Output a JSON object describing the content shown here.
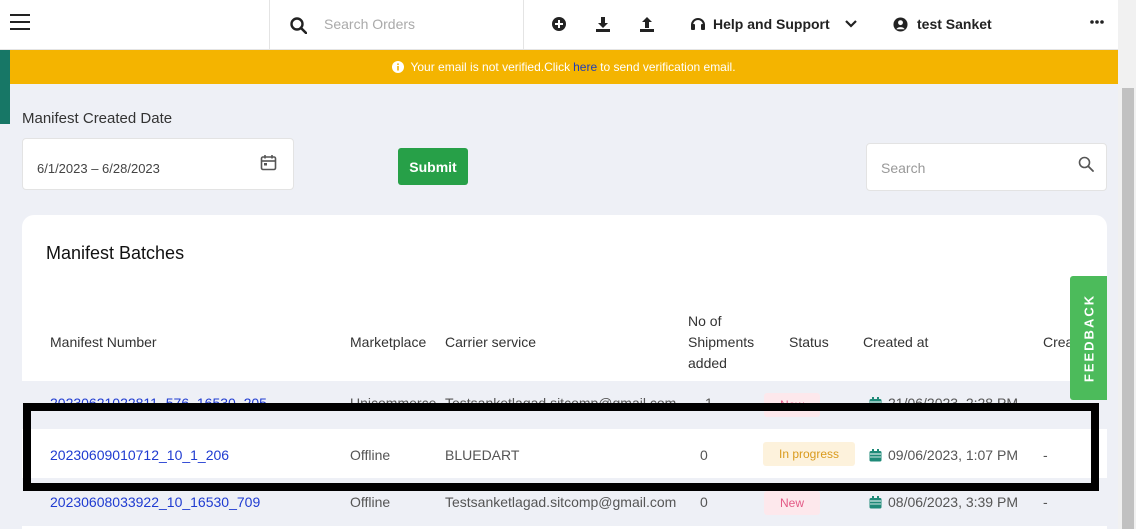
{
  "topbar": {
    "search_placeholder": "Search Orders",
    "help_label": "Help and Support",
    "user_name": "test Sanket"
  },
  "notice": {
    "text_before": "Your email is not verified.Click",
    "link": "here",
    "text_after": "to send verification email."
  },
  "filter": {
    "label": "Manifest Created Date",
    "date_range": "6/1/2023 – 6/28/2023",
    "submit_label": "Submit",
    "search_placeholder": "Search"
  },
  "card": {
    "title": "Manifest Batches",
    "headers": {
      "manifest_number": "Manifest Number",
      "marketplace": "Marketplace",
      "carrier_service": "Carrier service",
      "shipments_added": "No of\nShipments\nadded",
      "status": "Status",
      "created_at": "Created at",
      "created_by": "Crea"
    },
    "rows": [
      {
        "number": "20230621022811_576_16530_205",
        "marketplace": "Unicommerce",
        "carrier": "Testsanketlagad.sitcomp@gmail.com",
        "shipments": "1",
        "status": "New",
        "status_color": "#e35a86",
        "created_at": "21/06/2023, 2:28 PM",
        "created_by": ""
      },
      {
        "number": "20230609010712_10_1_206",
        "marketplace": "Offline",
        "carrier": "BLUEDART",
        "shipments": "0",
        "status": "In progress",
        "status_color": "#d99a1c",
        "created_at": "09/06/2023, 1:07 PM",
        "created_by": "-"
      },
      {
        "number": "20230608033922_10_16530_709",
        "marketplace": "Offline",
        "carrier": "Testsanketlagad.sitcomp@gmail.com",
        "shipments": "0",
        "status": "New",
        "status_color": "#e35a86",
        "created_at": "08/06/2023, 3:39 PM",
        "created_by": "-"
      }
    ]
  },
  "feedback_label": "FEEDBACK",
  "colors": {
    "notice_bg": "#f4b400",
    "submit_bg": "#27a048",
    "link": "#1f3bd1",
    "feedback_bg": "#4cbb5b",
    "sidebar_accent": "#177766"
  },
  "icons": [
    "menu-icon",
    "search-icon",
    "add-circle-icon",
    "download-icon",
    "upload-icon",
    "headset-icon",
    "chevron-down-icon",
    "user-circle-icon",
    "more-horizontal-icon",
    "info-icon",
    "calendar-icon"
  ]
}
